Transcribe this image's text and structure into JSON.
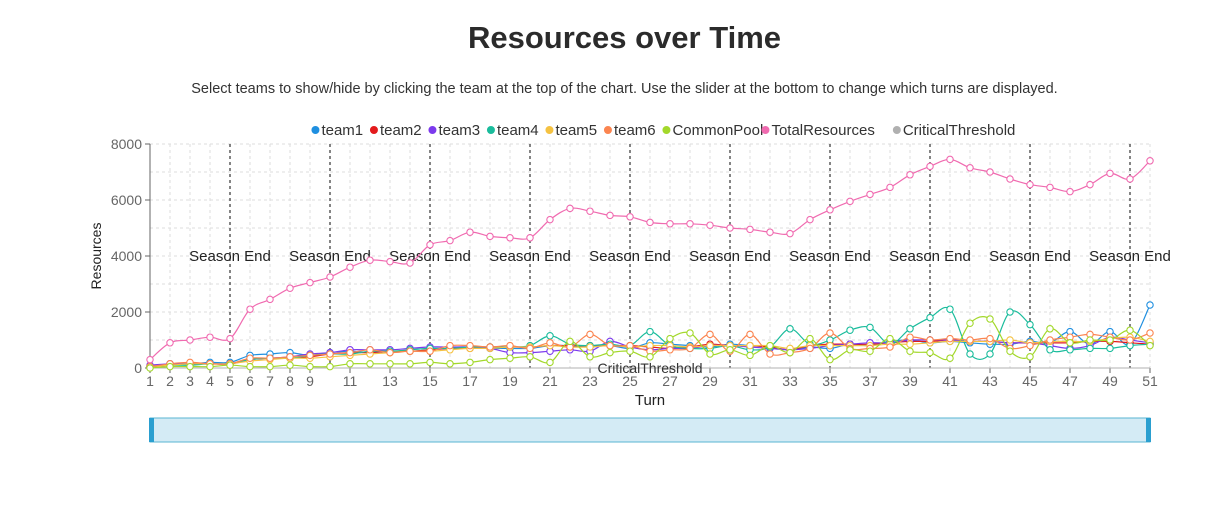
{
  "page": {
    "title": "Resources over Time",
    "subtitle": "Select teams to show/hide by clicking the team at the top of the chart. Use the slider at the bottom to change which turns are displayed."
  },
  "chart_data": {
    "type": "line",
    "xlabel": "Turn",
    "ylabel": "Resources",
    "xlim": [
      1,
      51
    ],
    "ylim": [
      0,
      8000
    ],
    "yticks": [
      0,
      2000,
      4000,
      6000,
      8000
    ],
    "xticks": [
      1,
      2,
      3,
      4,
      5,
      6,
      7,
      8,
      9,
      11,
      13,
      15,
      17,
      19,
      21,
      23,
      25,
      27,
      29,
      31,
      33,
      35,
      37,
      39,
      41,
      43,
      45,
      47,
      49,
      51
    ],
    "grid": true,
    "legend_position": "top",
    "season_end_turns": [
      5,
      10,
      15,
      20,
      25,
      30,
      35,
      40,
      45,
      50
    ],
    "season_end_label": "Season End",
    "critical_threshold_label": "CriticalThreshold",
    "critical_threshold_value": 0,
    "x": [
      1,
      2,
      3,
      4,
      5,
      6,
      7,
      8,
      9,
      10,
      11,
      12,
      13,
      14,
      15,
      16,
      17,
      18,
      19,
      20,
      21,
      22,
      23,
      24,
      25,
      26,
      27,
      28,
      29,
      30,
      31,
      32,
      33,
      34,
      35,
      36,
      37,
      38,
      39,
      40,
      41,
      42,
      43,
      44,
      45,
      46,
      47,
      48,
      49,
      50,
      51
    ],
    "series": [
      {
        "name": "team1",
        "color": "#1f8fe0",
        "values": [
          50,
          150,
          150,
          200,
          200,
          450,
          500,
          550,
          450,
          550,
          600,
          550,
          600,
          600,
          650,
          700,
          750,
          700,
          700,
          700,
          800,
          800,
          750,
          800,
          700,
          900,
          850,
          800,
          750,
          850,
          800,
          750,
          650,
          750,
          700,
          850,
          800,
          950,
          1000,
          900,
          950,
          900,
          850,
          850,
          950,
          900,
          1300,
          850,
          1300,
          850,
          2250
        ]
      },
      {
        "name": "team2",
        "color": "#e31a1c",
        "values": [
          50,
          100,
          150,
          150,
          150,
          300,
          350,
          350,
          400,
          500,
          550,
          550,
          600,
          600,
          650,
          700,
          700,
          750,
          750,
          750,
          800,
          800,
          800,
          800,
          800,
          750,
          700,
          750,
          850,
          800,
          800,
          750,
          650,
          800,
          850,
          850,
          850,
          900,
          950,
          950,
          1000,
          950,
          950,
          900,
          900,
          900,
          900,
          950,
          950,
          900,
          850
        ]
      },
      {
        "name": "team3",
        "color": "#7c3aed",
        "values": [
          100,
          150,
          150,
          150,
          150,
          300,
          350,
          400,
          500,
          550,
          650,
          650,
          650,
          700,
          750,
          750,
          750,
          700,
          550,
          550,
          600,
          650,
          600,
          950,
          750,
          650,
          700,
          700,
          800,
          800,
          750,
          700,
          650,
          700,
          800,
          850,
          900,
          900,
          1000,
          1000,
          1000,
          950,
          950,
          900,
          900,
          800,
          700,
          800,
          1100,
          1000,
          900
        ]
      },
      {
        "name": "team4",
        "color": "#1abc9c",
        "values": [
          50,
          100,
          100,
          150,
          150,
          300,
          350,
          350,
          450,
          500,
          500,
          600,
          600,
          650,
          700,
          700,
          750,
          750,
          750,
          800,
          1150,
          850,
          800,
          850,
          800,
          1300,
          800,
          700,
          700,
          800,
          650,
          750,
          1400,
          850,
          1000,
          1350,
          1450,
          850,
          1400,
          1800,
          2100,
          500,
          500,
          2000,
          1550,
          650,
          650,
          700,
          700,
          800,
          850
        ]
      },
      {
        "name": "team5",
        "color": "#f5c242",
        "values": [
          50,
          100,
          150,
          150,
          150,
          250,
          300,
          350,
          350,
          400,
          450,
          500,
          550,
          600,
          600,
          650,
          700,
          700,
          750,
          750,
          800,
          750,
          750,
          800,
          750,
          800,
          800,
          750,
          800,
          800,
          800,
          800,
          700,
          800,
          800,
          800,
          800,
          850,
          850,
          900,
          950,
          950,
          950,
          1000,
          900,
          950,
          950,
          950,
          1050,
          1100,
          950
        ]
      },
      {
        "name": "team6",
        "color": "#fb8550",
        "values": [
          50,
          150,
          200,
          150,
          150,
          350,
          350,
          400,
          450,
          500,
          550,
          650,
          550,
          600,
          600,
          800,
          800,
          750,
          800,
          700,
          900,
          750,
          1200,
          800,
          800,
          600,
          650,
          700,
          1200,
          600,
          1200,
          500,
          550,
          700,
          1250,
          700,
          700,
          750,
          1100,
          1000,
          1050,
          1000,
          1050,
          700,
          800,
          1000,
          1100,
          1200,
          1100,
          1000,
          1250
        ]
      },
      {
        "name": "CommonPool",
        "color": "#a3d82b",
        "values": [
          0,
          50,
          50,
          50,
          100,
          50,
          50,
          100,
          50,
          50,
          150,
          150,
          150,
          150,
          200,
          150,
          200,
          300,
          350,
          400,
          200,
          950,
          400,
          550,
          600,
          400,
          1050,
          1250,
          500,
          650,
          450,
          800,
          550,
          1050,
          300,
          650,
          600,
          1050,
          600,
          550,
          350,
          1600,
          1750,
          600,
          400,
          1400,
          900,
          1000,
          1000,
          1350,
          800
        ]
      },
      {
        "name": "TotalResources",
        "color": "#f06bb0",
        "values": [
          300,
          900,
          1000,
          1100,
          1050,
          2100,
          2450,
          2850,
          3050,
          3250,
          3600,
          3850,
          3800,
          3750,
          4400,
          4550,
          4850,
          4700,
          4650,
          4650,
          5300,
          5700,
          5600,
          5450,
          5400,
          5200,
          5150,
          5150,
          5100,
          5000,
          4950,
          4850,
          4800,
          5300,
          5650,
          5950,
          6200,
          6450,
          6900,
          7200,
          7450,
          7150,
          7000,
          6750,
          6550,
          6450,
          6300,
          6550,
          6950,
          6750,
          7400
        ]
      },
      {
        "name": "CriticalThreshold",
        "color": "#b0b0b0",
        "values": []
      }
    ]
  },
  "slider": {
    "from_turn": 1,
    "to_turn": 51
  }
}
